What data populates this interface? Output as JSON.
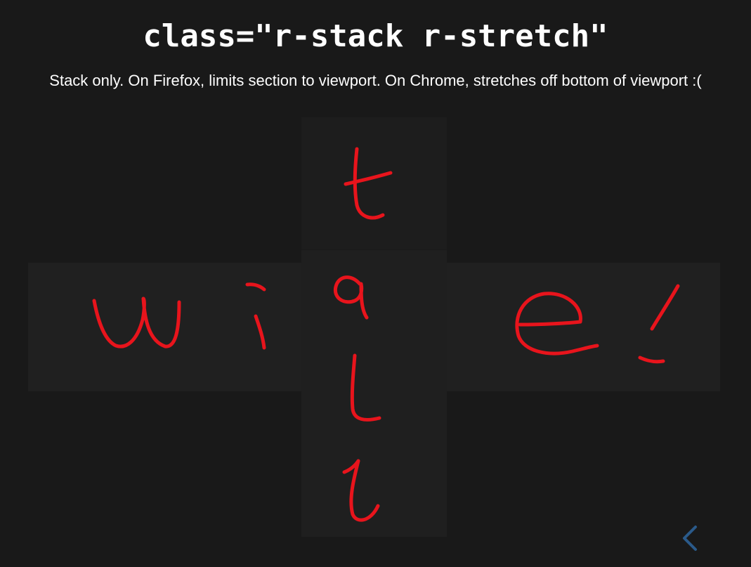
{
  "slide": {
    "title": "class=\"r-stack r-stretch\"",
    "subtitle": "Stack only. On Firefox, limits section to viewport. On Chrome, stretches off bottom of viewport :("
  },
  "handwriting": {
    "vertical_word": "tall",
    "horizontal_word": "wide!",
    "ink_color": "#e8141c"
  },
  "colors": {
    "background": "#191919",
    "panel": "#1f1f1f",
    "text": "#ffffff",
    "nav_arrow": "#2a5a8a"
  },
  "navigation": {
    "prev_icon": "chevron-left-icon"
  }
}
